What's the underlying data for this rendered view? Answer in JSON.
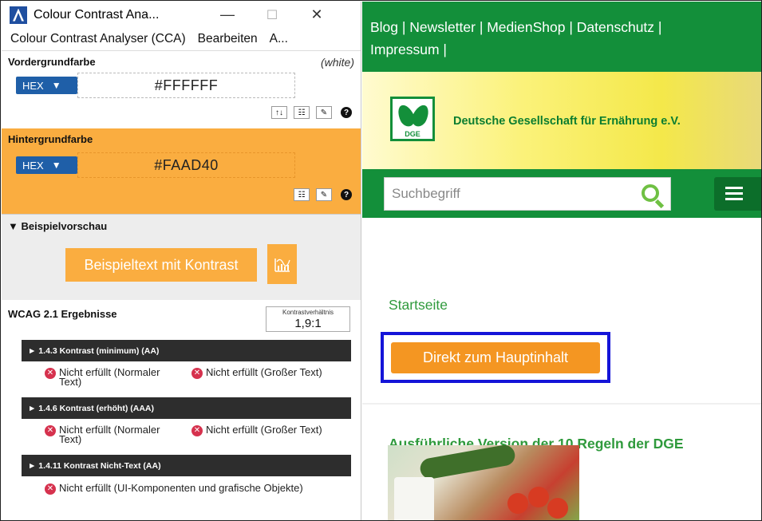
{
  "cca": {
    "window_title": "Colour Contrast Ana...",
    "window_controls": {
      "minimize": "—",
      "maximize": "☐",
      "close": "✕"
    },
    "menu": [
      "Colour Contrast Analyser (CCA)",
      "Bearbeiten",
      "A..."
    ],
    "foreground": {
      "label": "Vordergrundfarbe",
      "note": "(white)",
      "format": "HEX",
      "value": "#FFFFFF"
    },
    "background": {
      "label": "Hintergrundfarbe",
      "format": "HEX",
      "value": "#FAAD40"
    },
    "tools": {
      "swap": "↑↓",
      "sliders": "☷",
      "picker": "✎",
      "help": "?"
    },
    "preview": {
      "title": "▼ Beispielvorschau",
      "sample_text": "Beispieltext mit Kontrast"
    },
    "wcag": {
      "title": "WCAG 2.1 Ergebnisse",
      "ratio_label": "Kontrastverhältnis",
      "ratio_value": "1,9:1",
      "criteria": [
        {
          "title": "► 1.4.3 Kontrast (minimum) (AA)",
          "normal": "Nicht erfüllt (Normaler Text)",
          "large": "Nicht erfüllt (Großer Text)"
        },
        {
          "title": "► 1.4.6 Kontrast (erhöht) (AAA)",
          "normal": "Nicht erfüllt (Normaler Text)",
          "large": "Nicht erfüllt (Großer Text)"
        },
        {
          "title": "► 1.4.11 Kontrast Nicht-Text (AA)",
          "ui": "Nicht erfüllt (UI-Komponenten und grafische Objekte)"
        }
      ]
    }
  },
  "site": {
    "topnav_line1": "Blog | Newsletter | MedienShop | Datenschutz |",
    "topnav_line2": "Impressum |",
    "logo_text": "DGE",
    "org_name": "Deutsche Gesellschaft für Ernährung e.V.",
    "search_placeholder": "Suchbegriff",
    "breadcrumb": "Startseite",
    "skip_link": "Direkt zum Hauptinhalt",
    "article_title": "Ausführliche Version der 10 Regeln der DGE"
  },
  "colors": {
    "cca_accent": "#1f5fa8",
    "bg_color": "#faad40",
    "dge_green": "#138f3a",
    "dge_text_green": "#2f9a3c",
    "focus_outline": "#1414d8",
    "skip_button": "#f49622",
    "fail_red": "#d6324e"
  }
}
